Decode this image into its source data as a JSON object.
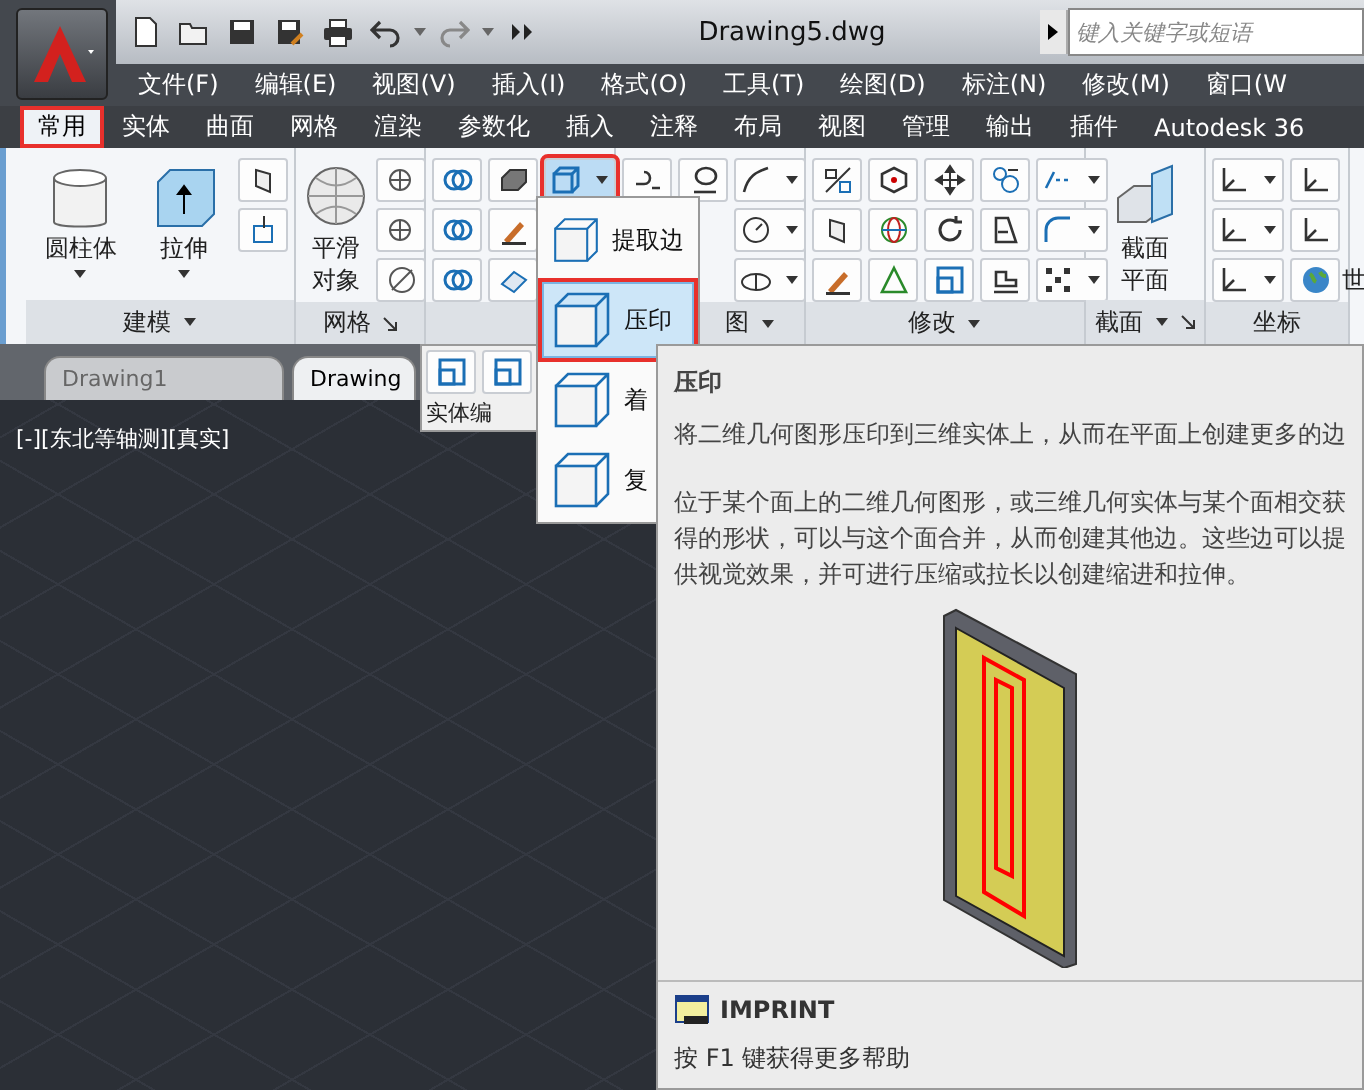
{
  "window": {
    "title": "Drawing5.dwg"
  },
  "search": {
    "placeholder": "键入关键字或短语"
  },
  "menu_bar": [
    "文件(F)",
    "编辑(E)",
    "视图(V)",
    "插入(I)",
    "格式(O)",
    "工具(T)",
    "绘图(D)",
    "标注(N)",
    "修改(M)",
    "窗口(W"
  ],
  "ribbon_tabs": [
    {
      "label": "常用",
      "selected": true,
      "annotated": true
    },
    {
      "label": "实体",
      "selected": false,
      "annotated": false
    },
    {
      "label": "曲面",
      "selected": false,
      "annotated": false
    },
    {
      "label": "网格",
      "selected": false,
      "annotated": false
    },
    {
      "label": "渲染",
      "selected": false,
      "annotated": false
    },
    {
      "label": "参数化",
      "selected": false,
      "annotated": false
    },
    {
      "label": "插入",
      "selected": false,
      "annotated": false
    },
    {
      "label": "注释",
      "selected": false,
      "annotated": false
    },
    {
      "label": "布局",
      "selected": false,
      "annotated": false
    },
    {
      "label": "视图",
      "selected": false,
      "annotated": false
    },
    {
      "label": "管理",
      "selected": false,
      "annotated": false
    },
    {
      "label": "输出",
      "selected": false,
      "annotated": false
    },
    {
      "label": "插件",
      "selected": false,
      "annotated": false
    },
    {
      "label": "Autodesk 36",
      "selected": false,
      "annotated": false
    }
  ],
  "ribbon_panels": [
    {
      "title": "建模",
      "has_menu": true,
      "large_buttons": [
        {
          "lines": [
            "圆柱体"
          ],
          "has_menu": true
        },
        {
          "lines": [
            "拉伸"
          ],
          "has_menu": true
        }
      ]
    },
    {
      "title": "网格",
      "has_launcher": true,
      "large_buttons": [
        {
          "lines": [
            "平滑",
            "对象"
          ],
          "has_menu": false
        }
      ]
    },
    {
      "tool_annotated": true
    },
    {
      "title": "图",
      "has_menu": true
    },
    {
      "title": "修改",
      "has_menu": true
    },
    {
      "title": "截面",
      "has_menu": true,
      "has_launcher": true,
      "large_buttons": [
        {
          "lines": [
            "截面",
            "平面"
          ],
          "has_menu": false
        }
      ]
    },
    {
      "title": "坐标",
      "cut_label": "世"
    }
  ],
  "doc_tabs": [
    {
      "label": "Drawing1",
      "selected": false
    },
    {
      "label": "Drawing",
      "selected": true
    }
  ],
  "floating_toolbar": {
    "title": "实体编"
  },
  "viewport": {
    "label": "[-][东北等轴测][真实]"
  },
  "dropdown": {
    "items": [
      {
        "label": "提取边",
        "selected": false,
        "annotated": false
      },
      {
        "label": "压印",
        "selected": true,
        "annotated": true
      },
      {
        "label": "着",
        "selected": false,
        "annotated": false
      },
      {
        "label": "复",
        "selected": false,
        "annotated": false
      }
    ]
  },
  "tooltip": {
    "title": "压印",
    "paragraphs": [
      "将二维几何图形压印到三维实体上，从而在平面上创建更多的边",
      "位于某个面上的二维几何图形，或三维几何实体与某个面相交获得的形状，可以与这个面合并，从而创建其他边。这些边可以提供视觉效果，并可进行压缩或拉长以创建缩进和拉伸。"
    ],
    "command": "IMPRINT",
    "help": "按 F1 键获得更多帮助"
  }
}
